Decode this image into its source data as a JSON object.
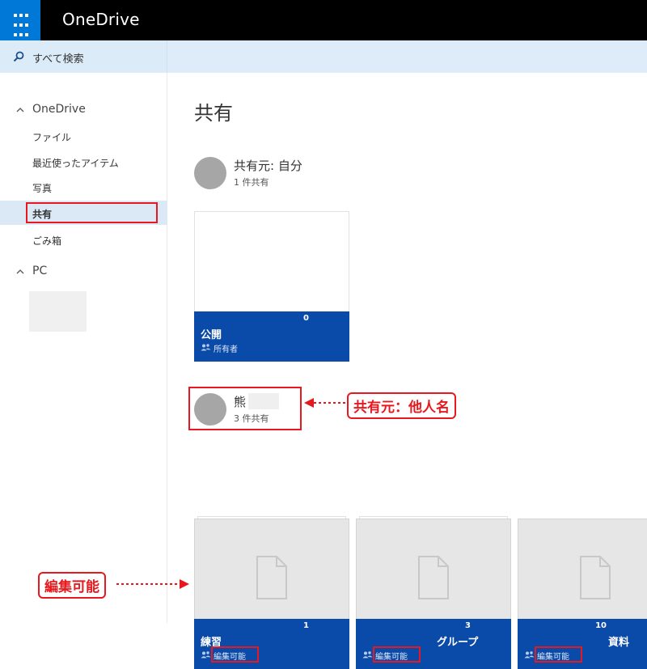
{
  "app": {
    "title": "OneDrive"
  },
  "search": {
    "label": "すべて検索"
  },
  "sidebar": {
    "group_onedrive": "OneDrive",
    "items": [
      {
        "label": "ファイル"
      },
      {
        "label": "最近使ったアイテム"
      },
      {
        "label": "写真"
      },
      {
        "label": "共有",
        "selected": true
      },
      {
        "label": "ごみ箱"
      }
    ],
    "group_pc": "PC"
  },
  "main": {
    "title": "共有",
    "sections": [
      {
        "owner": "共有元: 自分",
        "count": "1 件共有",
        "tiles": [
          {
            "name": "公開",
            "count": "0",
            "permission": "所有者",
            "icon": "people-icon"
          }
        ]
      },
      {
        "owner": "熊",
        "count": "3 件共有",
        "tiles": [
          {
            "name": "練習",
            "count": "1",
            "permission": "編集可能",
            "icon": "people-icon"
          },
          {
            "name": "グループ",
            "count": "3",
            "permission": "編集可能",
            "icon": "people-icon"
          },
          {
            "name": "資料",
            "count": "10",
            "permission": "編集可能",
            "icon": "people-icon"
          }
        ]
      }
    ]
  },
  "annotations": {
    "owner_callout": "共有元：他人名",
    "permission_callout": "編集可能"
  },
  "colors": {
    "accent": "#0078d7",
    "tile_bar": "#0a4aa8",
    "annotation_red": "#e8191e",
    "search_bg": "#deecf9"
  }
}
